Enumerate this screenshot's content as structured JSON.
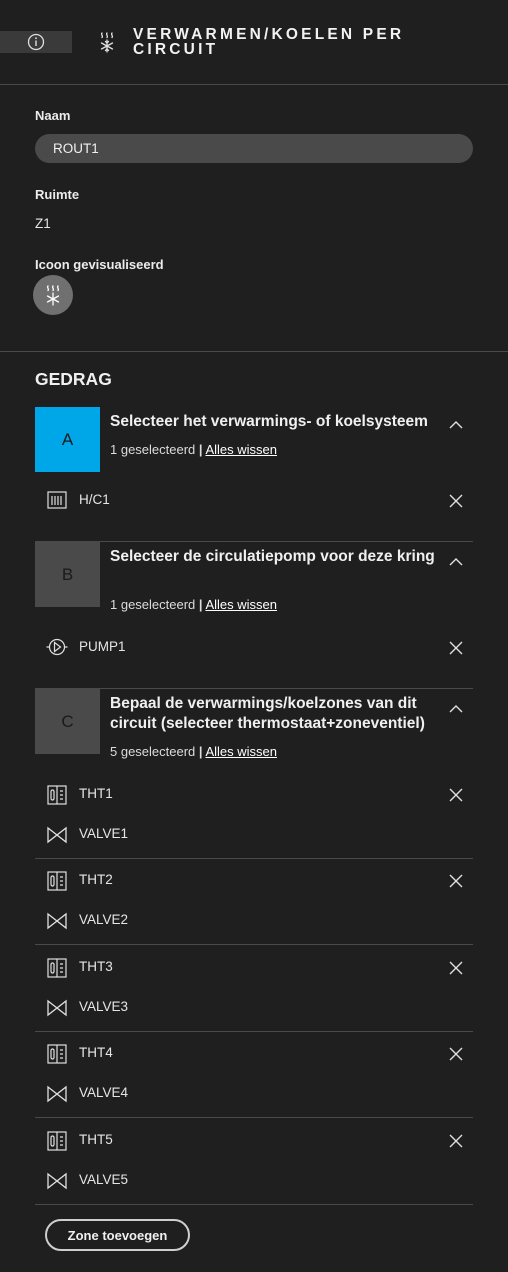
{
  "header": {
    "title": "VERWARMEN/KOELEN PER CIRCUIT",
    "icon": "heat-cool-icon",
    "info_icon": "info-icon"
  },
  "fields": {
    "name_label": "Naam",
    "name_value": "ROUT1",
    "room_label": "Ruimte",
    "room_value": "Z1",
    "icon_label": "Icoon gevisualiseerd"
  },
  "behaviour": {
    "title": "GEDRAG",
    "steps": [
      {
        "letter": "A",
        "title": "Selecteer het verwarmings- of koelsysteem",
        "count": "1 geselecteerd",
        "sep": "|",
        "clear": "Alles wissen",
        "color": "#00a7e8",
        "active": true
      },
      {
        "letter": "B",
        "title": "Selecteer de circulatiepomp voor deze kring",
        "count": "1 geselecteerd",
        "sep": "|",
        "clear": "Alles wissen",
        "color": "#4a4a4a",
        "active": false
      },
      {
        "letter": "C",
        "title": "Bepaal de verwarmings/koelzones van dit circuit (selecteer thermostaat+zoneventiel)",
        "count": "5 geselecteerd",
        "sep": "|",
        "clear": "Alles wissen",
        "color": "#4a4a4a",
        "active": false
      }
    ],
    "system": {
      "label": "H/C1",
      "icon": "heater-icon"
    },
    "pump": {
      "label": "PUMP1",
      "icon": "pump-icon"
    },
    "zones": [
      {
        "thermostat": "THT1",
        "valve": "VALVE1"
      },
      {
        "thermostat": "THT2",
        "valve": "VALVE2"
      },
      {
        "thermostat": "THT3",
        "valve": "VALVE3"
      },
      {
        "thermostat": "THT4",
        "valve": "VALVE4"
      },
      {
        "thermostat": "THT5",
        "valve": "VALVE5"
      }
    ],
    "add_zone_label": "Zone toevoegen"
  }
}
